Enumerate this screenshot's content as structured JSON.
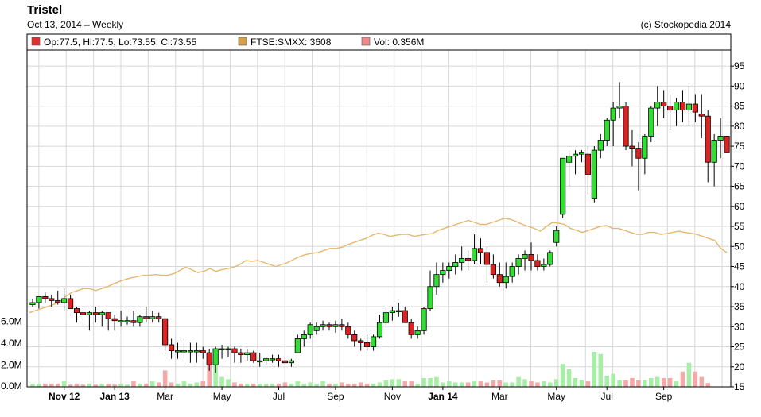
{
  "header": {
    "title": "Tristel",
    "subtitle": "Oct 13, 2014 – Weekly",
    "credit": "(c) Stockopedia 2014"
  },
  "legend": [
    {
      "label": "Op:77.5, Hi:77.5, Lo:73.55, Cl:73.55",
      "color": "#e03030"
    },
    {
      "label": "FTSE:SMXX: 3608",
      "color": "#d9a04a"
    },
    {
      "label": "Vol: 0.356M",
      "color": "#f08a8a"
    }
  ],
  "colors": {
    "up": "#33dd33",
    "down": "#dd2222",
    "index_line": "#e5b870",
    "vol_up": "#a6eea6",
    "vol_down": "#f4a8a8",
    "grid": "#d8d8d8",
    "frame": "#000000"
  },
  "chart_data": {
    "type": "candlestick",
    "price_axis": {
      "side": "right",
      "min": 15,
      "max": 97,
      "ticks": [
        95,
        90,
        85,
        80,
        75,
        70,
        65,
        60,
        55,
        50,
        45,
        40,
        35,
        30,
        25,
        20,
        15
      ]
    },
    "volume_axis": {
      "side": "left",
      "min": 0,
      "max": 8,
      "unit": "M",
      "ticks": [
        "6.0M",
        "4.0M",
        "2.0M",
        "0.0M"
      ],
      "tick_values": [
        6,
        4,
        2,
        0
      ]
    },
    "x_labels": [
      {
        "label": "Nov 12",
        "week": 5
      },
      {
        "label": "Jan 13",
        "week": 13
      },
      {
        "label": "Mar",
        "week": 21
      },
      {
        "label": "May",
        "week": 30
      },
      {
        "label": "Jul",
        "week": 39
      },
      {
        "label": "Sep",
        "week": 48
      },
      {
        "label": "Nov",
        "week": 57
      },
      {
        "label": "Jan 14",
        "week": 65
      },
      {
        "label": "Mar",
        "week": 74
      },
      {
        "label": "May",
        "week": 83
      },
      {
        "label": "Jul",
        "week": 91
      },
      {
        "label": "Sep",
        "week": 100
      }
    ],
    "grid": true,
    "candles": [
      [
        35.5,
        37,
        35,
        36
      ],
      [
        36,
        37.5,
        34.5,
        37.5
      ],
      [
        37.5,
        38.5,
        36,
        37
      ],
      [
        37,
        38,
        35,
        36.5
      ],
      [
        36.5,
        39,
        35.5,
        36
      ],
      [
        36,
        39.5,
        34,
        37
      ],
      [
        37,
        38,
        35,
        34.5
      ],
      [
        34.5,
        35,
        31,
        33.5
      ],
      [
        33.5,
        34.5,
        30,
        33
      ],
      [
        33,
        34,
        29,
        33.5
      ],
      [
        33.5,
        35,
        31,
        33
      ],
      [
        33,
        34,
        30,
        33.5
      ],
      [
        33.5,
        33.5,
        29,
        32
      ],
      [
        32,
        33,
        29,
        31.5
      ],
      [
        31.5,
        34,
        30,
        31.5
      ],
      [
        31.5,
        32.5,
        30.5,
        31.5
      ],
      [
        31.5,
        34,
        30,
        31
      ],
      [
        31,
        33,
        30,
        32.5
      ],
      [
        32.5,
        35,
        31,
        32
      ],
      [
        32,
        34,
        31,
        32.5
      ],
      [
        32.5,
        33.5,
        31,
        32
      ],
      [
        32,
        32,
        24,
        25.5
      ],
      [
        25.5,
        27,
        22,
        24
      ],
      [
        24,
        26,
        22,
        24
      ],
      [
        24,
        27,
        22,
        24
      ],
      [
        24,
        26,
        21,
        24
      ],
      [
        24,
        26,
        21,
        24
      ],
      [
        24,
        25,
        22,
        23.5
      ],
      [
        23.5,
        24.5,
        19,
        20.5
      ],
      [
        20.5,
        25,
        18.5,
        24.5
      ],
      [
        24.5,
        25.5,
        22,
        24.5
      ],
      [
        24.5,
        25,
        22.5,
        24.5
      ],
      [
        24.5,
        25,
        21,
        23.5
      ],
      [
        23.5,
        24.5,
        21,
        23
      ],
      [
        23,
        24.5,
        21.5,
        23.5
      ],
      [
        23.5,
        24,
        21,
        21.5
      ],
      [
        21.5,
        23.5,
        20,
        21.5
      ],
      [
        21.5,
        22.5,
        20.5,
        22
      ],
      [
        22,
        23,
        21,
        22
      ],
      [
        22,
        23,
        20,
        21.5
      ],
      [
        21.5,
        22.5,
        20,
        21
      ],
      [
        21,
        22,
        20,
        21.5
      ],
      [
        23.5,
        28,
        23.5,
        27
      ],
      [
        27,
        29,
        25,
        28
      ],
      [
        28,
        31,
        27,
        30.5
      ],
      [
        29,
        31,
        28,
        30
      ],
      [
        30,
        31.5,
        29,
        30.5
      ],
      [
        30.5,
        31,
        29,
        30
      ],
      [
        30,
        31.5,
        28.5,
        30.5
      ],
      [
        30.5,
        32,
        29,
        30
      ],
      [
        30,
        31,
        27,
        28
      ],
      [
        28,
        29,
        25,
        26.5
      ],
      [
        26.5,
        27,
        24,
        26
      ],
      [
        26,
        28,
        24,
        25
      ],
      [
        25,
        28,
        24,
        27.5
      ],
      [
        27.5,
        33,
        27,
        31
      ],
      [
        31,
        35,
        30,
        33.5
      ],
      [
        33.5,
        35,
        31.5,
        34
      ],
      [
        34,
        36,
        32.5,
        34
      ],
      [
        34,
        35,
        31,
        31
      ],
      [
        31,
        32,
        27,
        28
      ],
      [
        28,
        30,
        27,
        29
      ],
      [
        29,
        35,
        28,
        34.5
      ],
      [
        34.5,
        44,
        34,
        40
      ],
      [
        40,
        46,
        38,
        43
      ],
      [
        43,
        46,
        41,
        44
      ],
      [
        44,
        46,
        42,
        45
      ],
      [
        45,
        48,
        43,
        46
      ],
      [
        46,
        50,
        44,
        47
      ],
      [
        47,
        49,
        44,
        46.5
      ],
      [
        46.5,
        53,
        45.5,
        49.5
      ],
      [
        49.5,
        52,
        45.5,
        48.5
      ],
      [
        48.5,
        50,
        41,
        45.5
      ],
      [
        45.5,
        48,
        42,
        43
      ],
      [
        43,
        46,
        40,
        41
      ],
      [
        41,
        46,
        39.5,
        42.5
      ],
      [
        42.5,
        46,
        41,
        45
      ],
      [
        45,
        48,
        43,
        47
      ],
      [
        47,
        49,
        44,
        48
      ],
      [
        48,
        51,
        44,
        46.5
      ],
      [
        46.5,
        48,
        44,
        45
      ],
      [
        45,
        47,
        44,
        45.5
      ],
      [
        45.5,
        49,
        45,
        48.5
      ],
      [
        51,
        55,
        50,
        54
      ],
      [
        58,
        64,
        57,
        72
      ],
      [
        71,
        74,
        65,
        72.5
      ],
      [
        72.5,
        74,
        68,
        73
      ],
      [
        73,
        74,
        71,
        73.5
      ],
      [
        73,
        75,
        63,
        68
      ],
      [
        62,
        75,
        61,
        74
      ],
      [
        74,
        78,
        72,
        76.5
      ],
      [
        76.5,
        82,
        75,
        81.5
      ],
      [
        81.5,
        86,
        75,
        84.5
      ],
      [
        84.5,
        91,
        82,
        85
      ],
      [
        85,
        86,
        74,
        75
      ],
      [
        75,
        79,
        70,
        74.5
      ],
      [
        74.5,
        76,
        64,
        72
      ],
      [
        72,
        78,
        68,
        77.5
      ],
      [
        77.5,
        85,
        76,
        84.5
      ],
      [
        84.5,
        90,
        80,
        86
      ],
      [
        86,
        89,
        82,
        85
      ],
      [
        85,
        88,
        79,
        84
      ],
      [
        84,
        87,
        80,
        86
      ],
      [
        86,
        89,
        81,
        84
      ],
      [
        84,
        90,
        80,
        85.5
      ],
      [
        85.5,
        88,
        81,
        83.5
      ],
      [
        83,
        88,
        77,
        82.5
      ],
      [
        82.5,
        84,
        66,
        71
      ],
      [
        71,
        78,
        65,
        76.5
      ],
      [
        76.5,
        82,
        72,
        77.5
      ],
      [
        77.5,
        77.5,
        73.55,
        73.55
      ]
    ],
    "volume": [
      0.3,
      0.3,
      0.3,
      0.3,
      0.3,
      0.5,
      0.2,
      0.3,
      0.2,
      0.3,
      0.2,
      0.3,
      0.3,
      0.2,
      0.3,
      0.2,
      0.5,
      0.3,
      0.3,
      0.5,
      0.4,
      1.5,
      0.4,
      0.3,
      0.5,
      0.3,
      0.4,
      0.5,
      2.1,
      2.6,
      0.9,
      0.7,
      0.4,
      0.3,
      0.3,
      0.3,
      0.3,
      0.3,
      0.3,
      0.3,
      0.4,
      0.3,
      0.5,
      0.3,
      0.4,
      0.3,
      0.5,
      0.3,
      0.3,
      0.4,
      0.3,
      0.3,
      0.4,
      0.3,
      0.3,
      0.4,
      0.6,
      0.7,
      0.7,
      0.5,
      0.5,
      0.3,
      0.8,
      0.8,
      0.9,
      0.4,
      0.5,
      0.4,
      0.4,
      0.4,
      0.5,
      0.5,
      0.4,
      0.6,
      0.6,
      0.4,
      0.4,
      0.9,
      0.7,
      0.5,
      0.4,
      0.5,
      0.4,
      0.7,
      2.1,
      1.6,
      0.8,
      0.6,
      0.5,
      3.2,
      3.0,
      1.0,
      1.2,
      0.6,
      0.6,
      0.8,
      0.6,
      0.6,
      0.8,
      0.9,
      0.8,
      0.8,
      0.5,
      1.4,
      2.2,
      1.4,
      0.9,
      0.356
    ],
    "index_series": {
      "name": "FTSE:SMXX",
      "values": [
        33.5,
        34.0,
        34.5,
        35.0,
        35.5,
        36.2,
        37.5,
        38.5,
        39.0,
        39.5,
        39.5,
        39.0,
        39.5,
        40.0,
        40.7,
        41.3,
        41.8,
        42.2,
        42.5,
        42.8,
        42.8,
        43.0,
        42.8,
        42.8,
        43.2,
        44.0,
        44.8,
        44.2,
        43.5,
        43.8,
        44.5,
        43.8,
        44.2,
        44.5,
        44.8,
        45.5,
        46.5,
        46.3,
        46.5,
        46.0,
        45.5,
        45.0,
        45.5,
        46.0,
        46.8,
        47.5,
        48.0,
        48.3,
        48.5,
        49.0,
        49.5,
        49.5,
        49.8,
        50.5,
        51.0,
        51.5,
        52.0,
        52.8,
        53.3,
        53.0,
        52.5,
        52.8,
        53.0,
        53.0,
        52.5,
        52.8,
        53.0,
        53.2,
        54.0,
        54.5,
        55.0,
        55.5,
        56.0,
        56.5,
        56.0,
        55.5,
        55.5,
        56.0,
        56.5,
        57.0,
        56.8,
        56.2,
        55.5,
        55.0,
        54.5,
        53.8,
        55.0,
        56.0,
        55.8,
        55.5,
        54.5,
        54.0,
        53.5,
        54.0,
        54.5,
        55.0,
        55.2,
        54.5,
        54.5,
        54.0,
        53.5,
        53.0,
        53.0,
        53.5,
        53.5,
        53.0,
        53.2,
        53.5,
        53.8,
        53.5,
        53.3,
        53.0,
        52.5,
        52.0,
        51.5,
        49.5,
        48.5
      ]
    }
  }
}
